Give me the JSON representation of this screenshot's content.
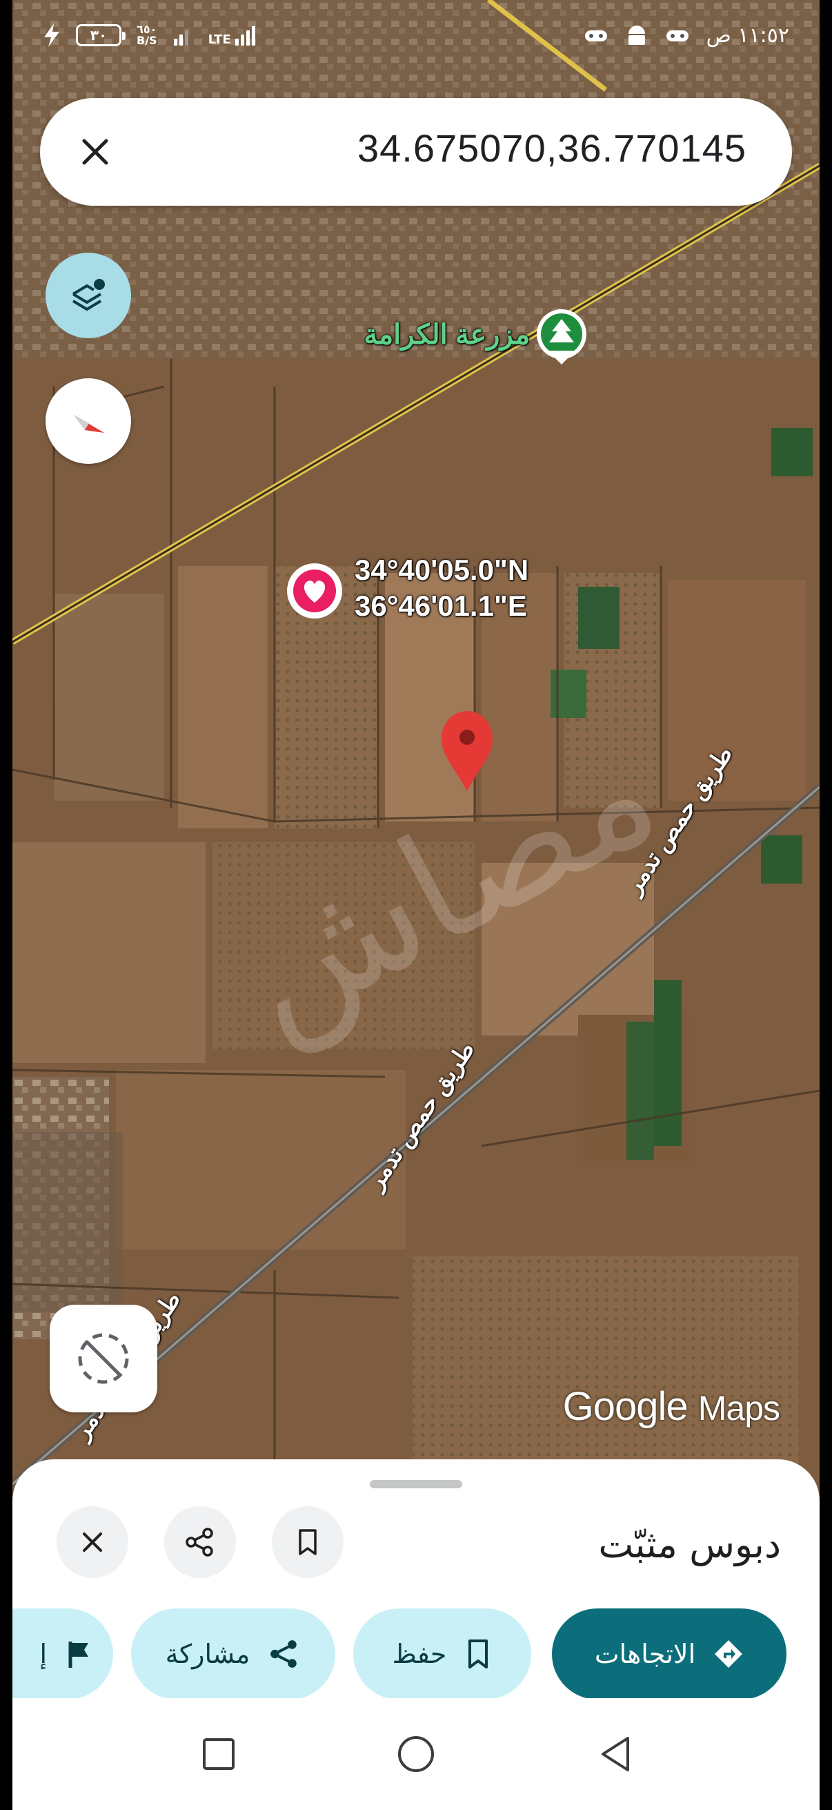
{
  "status_bar": {
    "time": "١١:٥٢ ص",
    "network": "LTE",
    "speed_value": "٦٥٠",
    "speed_unit": "B/S",
    "battery": "٣٠"
  },
  "search": {
    "value": "34.675070,36.770145"
  },
  "map": {
    "place_label": "مزرعة الكرامة",
    "coordinates_line1": "34°40'05.0\"N",
    "coordinates_line2": "36°46'01.1\"E",
    "road_label": "طريق حمص تدمر",
    "logo_google": "Google",
    "logo_maps": "Maps"
  },
  "bottom_sheet": {
    "title": "دبوس مثبّت",
    "chips": {
      "directions": "الاتجاهات",
      "save": "حفظ",
      "share": "مشاركة",
      "report": "إ"
    }
  },
  "colors": {
    "accent_teal": "#0b6e7a",
    "chip_bg": "#c9f0f7",
    "pin_red": "#e53935",
    "favorite_pink": "#e91e63",
    "place_green": "#1e8e3e"
  },
  "icons": [
    "close-icon",
    "layers-icon",
    "compass-icon",
    "location-off-icon",
    "share-icon",
    "bookmark-icon",
    "directions-icon",
    "flag-icon",
    "tree-icon",
    "heart-icon",
    "pin-icon"
  ]
}
